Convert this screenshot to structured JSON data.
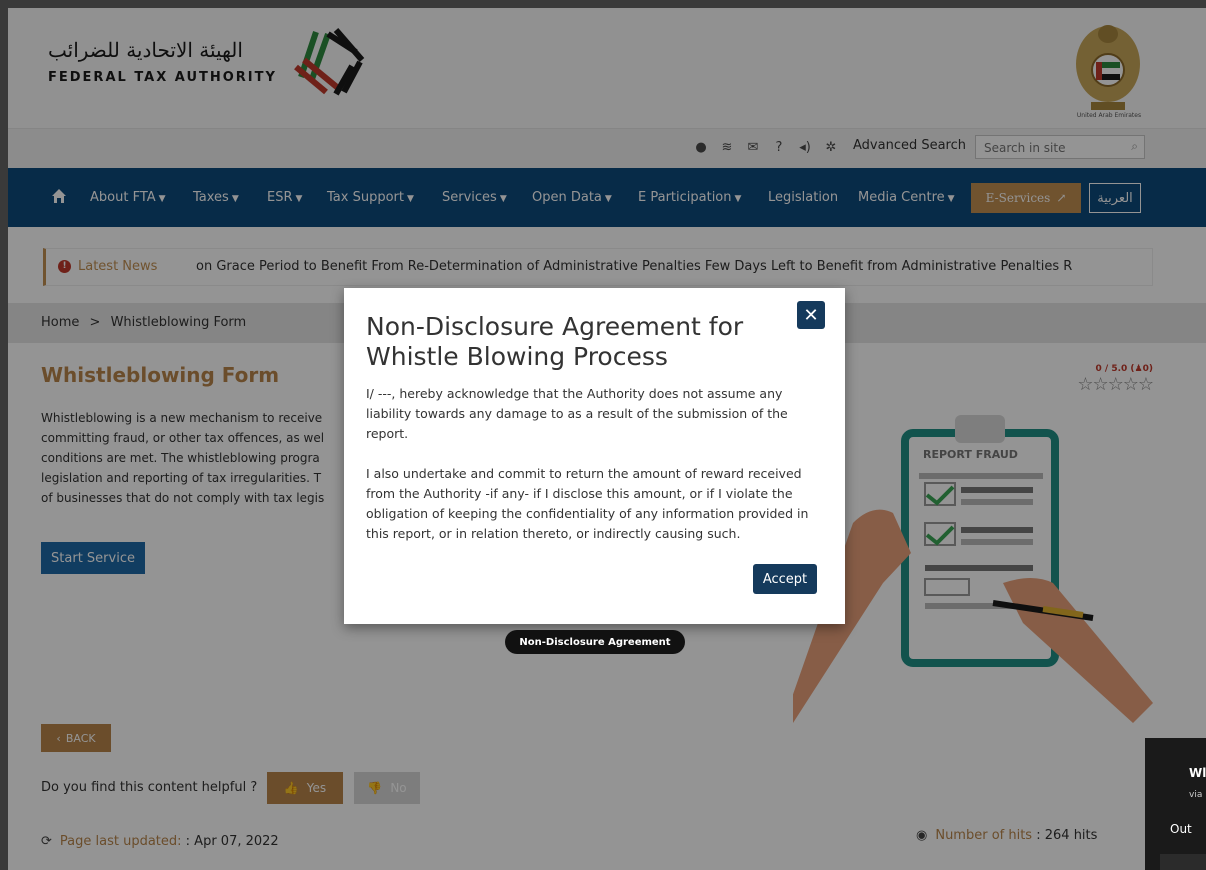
{
  "header": {
    "logo_ar": "الهيئة الاتحادية للضرائب",
    "logo_en": "FEDERAL TAX AUTHORITY",
    "emblem_label": "United Arab Emirates"
  },
  "toolbar": {
    "icons": [
      "info-icon",
      "wifi-icon",
      "mail-icon",
      "help-icon",
      "speaker-icon",
      "gear-icon"
    ],
    "advanced_search": "Advanced Search",
    "search_placeholder": "Search in site"
  },
  "nav": {
    "items": [
      {
        "label": "About FTA",
        "has_menu": true
      },
      {
        "label": "Taxes",
        "has_menu": true
      },
      {
        "label": "ESR",
        "has_menu": true
      },
      {
        "label": "Tax Support",
        "has_menu": true
      },
      {
        "label": "Services",
        "has_menu": true
      },
      {
        "label": "Open Data",
        "has_menu": true
      },
      {
        "label": "E Participation",
        "has_menu": true
      },
      {
        "label": "Legislation",
        "has_menu": false
      },
      {
        "label": "Media Centre",
        "has_menu": true
      }
    ],
    "eservices": "E-Services",
    "arabic": "العربية"
  },
  "news": {
    "label": "Latest News",
    "ticker": "on Grace Period to Benefit From Re-Determination of Administrative Penalties   Few Days Left to Benefit from Administrative Penalties R"
  },
  "breadcrumb": {
    "home": "Home",
    "separator": ">",
    "current": "Whistleblowing Form"
  },
  "main": {
    "title": "Whistleblowing Form",
    "rating": {
      "score": "0 / 5.0",
      "count": "0"
    },
    "intro_lines": [
      "Whistleblowing is a new mechanism to receive",
      "committing fraud, or other tax offences, as wel",
      "conditions are met. The whistleblowing progra",
      "legislation and reporting of tax irregularities. T",
      "of businesses that do not comply with tax legis"
    ],
    "start_button": "Start Service",
    "illustration_label": "REPORT FRAUD",
    "back_button": "BACK",
    "helpful_question": "Do you find this content helpful ?",
    "yes_button": "Yes",
    "no_button": "No",
    "last_updated_label": "Page last updated:",
    "last_updated_value": ": Apr 07, 2022",
    "hits_label": "Number of hits",
    "hits_value": ": 264 hits"
  },
  "widget": {
    "line1": "Wl",
    "line2": "via",
    "line3": "Out"
  },
  "modal": {
    "title": "Non-Disclosure Agreement for Whistle Blowing Process",
    "paragraph1": "I/ ---, hereby acknowledge that the Authority does not assume any liability towards any damage to as a result of the submission of the report.",
    "paragraph2": "I also undertake and commit to return the amount of reward received from the Authority -if any- if I disclose this amount, or if I violate the obligation of keeping the confidentiality of any information provided in this report, or in relation thereto, or indirectly causing such.",
    "accept_button": "Accept",
    "close_label": "✕"
  },
  "tooltip": "Non-Disclosure Agreement",
  "colors": {
    "nav": "#0d4a7d",
    "gold": "#b8864b",
    "modal_button": "#153a5c",
    "start_button": "#1e6aa8"
  }
}
